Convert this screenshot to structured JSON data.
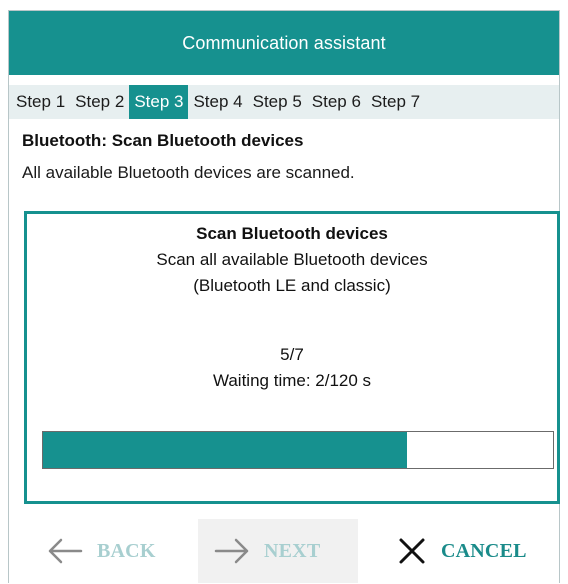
{
  "window": {
    "title": "Communication assistant"
  },
  "steps": {
    "items": [
      "Step 1",
      "Step 2",
      "Step 3",
      "Step 4",
      "Step 5",
      "Step 6",
      "Step 7"
    ],
    "active_index": 2
  },
  "section": {
    "title": "Bluetooth: Scan Bluetooth devices",
    "description": "All available Bluetooth devices are scanned."
  },
  "scan": {
    "title": "Scan Bluetooth devices",
    "line1": "Scan all available Bluetooth devices",
    "line2": "(Bluetooth LE and classic)",
    "counter": "5/7",
    "waiting": "Waiting time: 2/120 s",
    "progress_fraction": 0.714
  },
  "buttons": {
    "back": {
      "label": "BACK",
      "icon": "arrow-left-icon",
      "enabled": false
    },
    "next": {
      "label": "NEXT",
      "icon": "arrow-right-icon",
      "enabled": false
    },
    "cancel": {
      "label": "CANCEL",
      "icon": "close-icon",
      "enabled": true
    }
  },
  "colors": {
    "accent": "#16918f",
    "disabled_text": "#a8cfd0",
    "step_bar_bg": "#e7eff0"
  }
}
